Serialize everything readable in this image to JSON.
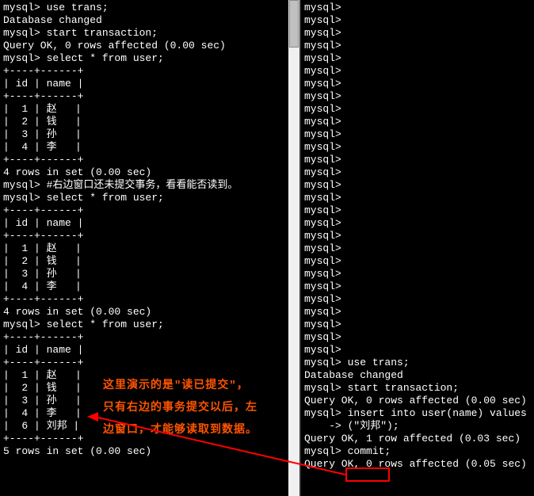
{
  "left": {
    "lines": [
      "mysql> use trans;",
      "Database changed",
      "mysql> start transaction;",
      "Query OK, 0 rows affected (0.00 sec)",
      "",
      "mysql> select * from user;",
      "+----+------+",
      "| id | name |",
      "+----+------+",
      "|  1 | 赵   |",
      "|  2 | 钱   |",
      "|  3 | 孙   |",
      "|  4 | 李   |",
      "+----+------+",
      "4 rows in set (0.00 sec)",
      "",
      "mysql> #右边窗口还未提交事务，看看能否读到。",
      "mysql> select * from user;",
      "+----+------+",
      "| id | name |",
      "+----+------+",
      "|  1 | 赵   |",
      "|  2 | 钱   |",
      "|  3 | 孙   |",
      "|  4 | 李   |",
      "+----+------+",
      "4 rows in set (0.00 sec)",
      "",
      "mysql> select * from user;",
      "+----+------+",
      "| id | name |",
      "+----+------+",
      "|  1 | 赵   |",
      "|  2 | 钱   |",
      "|  3 | 孙   |",
      "|  4 | 李   |",
      "|  6 | 刘邦 |",
      "+----+------+",
      "5 rows in set (0.00 sec)"
    ]
  },
  "right": {
    "lines": [
      "mysql>",
      "mysql>",
      "mysql>",
      "mysql>",
      "mysql>",
      "mysql>",
      "mysql>",
      "mysql>",
      "mysql>",
      "mysql>",
      "mysql>",
      "mysql>",
      "mysql>",
      "mysql>",
      "mysql>",
      "mysql>",
      "mysql>",
      "mysql>",
      "mysql>",
      "mysql>",
      "mysql>",
      "mysql>",
      "mysql>",
      "mysql>",
      "mysql>",
      "mysql>",
      "mysql>",
      "mysql>",
      "mysql> use trans;",
      "Database changed",
      "mysql> start transaction;",
      "Query OK, 0 rows affected (0.00 sec)",
      "",
      "mysql> insert into user(name) values",
      "    -> (\"刘邦\");",
      "Query OK, 1 row affected (0.03 sec)",
      "",
      "mysql> commit;",
      "Query OK, 0 rows affected (0.05 sec)"
    ]
  },
  "annotation": {
    "line1": "这里演示的是\"读已提交\"，",
    "line2": "只有右边的事务提交以后，左",
    "line3": "边窗口，才能够读取到数据。"
  }
}
